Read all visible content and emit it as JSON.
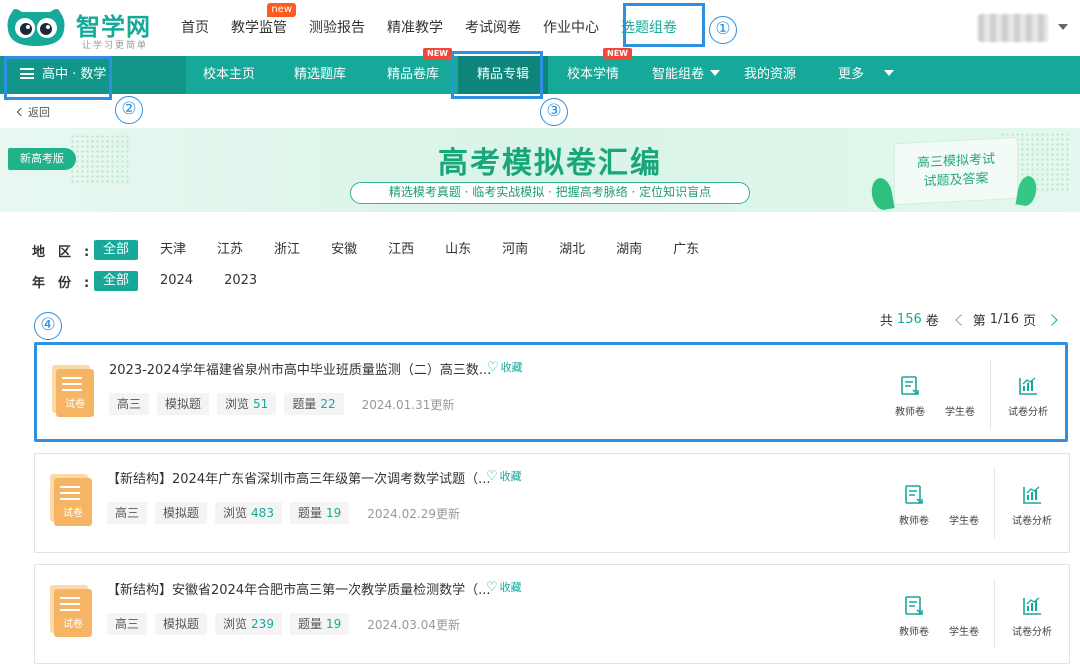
{
  "brand": {
    "name": "智学网",
    "slogan": "让学习更简单",
    "accent": "#16a99a"
  },
  "top_nav": [
    {
      "label": "首页"
    },
    {
      "label": "教学监管",
      "badge": "new"
    },
    {
      "label": "测验报告"
    },
    {
      "label": "精准教学"
    },
    {
      "label": "考试阅卷"
    },
    {
      "label": "作业中心"
    },
    {
      "label": "选题组卷",
      "active": true
    }
  ],
  "sub_nav": {
    "subject": "高中 · 数学",
    "items": [
      {
        "label": "校本主页"
      },
      {
        "label": "精选题库"
      },
      {
        "label": "精品卷库",
        "badge": "NEW"
      },
      {
        "label": "精品专辑",
        "active": true
      },
      {
        "label": "校本学情",
        "badge": "NEW"
      },
      {
        "label": "智能组卷",
        "dropdown": true
      },
      {
        "label": "我的资源"
      },
      {
        "label": "更多",
        "dropdown": true
      }
    ]
  },
  "back_label": "返回",
  "banner": {
    "tag": "新高考版",
    "title": "高考模拟卷汇编",
    "subtitle": "精选模考真题 · 临考实战模拟 · 把握高考脉络 · 定位知识盲点",
    "card_line1": "高三模拟考试",
    "card_line2": "试题及答案"
  },
  "filters": {
    "region_label": "地区",
    "regions": [
      "全部",
      "天津",
      "江苏",
      "浙江",
      "安徽",
      "江西",
      "山东",
      "河南",
      "湖北",
      "湖南",
      "广东"
    ],
    "year_label": "年份",
    "years": [
      "全部",
      "2024",
      "2023"
    ]
  },
  "pager": {
    "total_prefix": "共",
    "total": "156",
    "total_suffix": "卷",
    "page_prefix": "第",
    "page": "1/16",
    "page_suffix": "页"
  },
  "papers": [
    {
      "icon_label": "试卷",
      "title": "2023-2024学年福建省泉州市高中毕业班质量监测（二）高三数...",
      "fav_label": "收藏",
      "grade": "高三",
      "kind": "模拟题",
      "views_label": "浏览",
      "views": "51",
      "questions_label": "题量",
      "questions": "22",
      "date": "2024.01.31更新",
      "teacher_label": "教师卷",
      "student_label": "学生卷",
      "analysis_label": "试卷分析"
    },
    {
      "icon_label": "试卷",
      "title": "【新结构】2024年广东省深圳市高三年级第一次调考数学试题（...",
      "fav_label": "收藏",
      "grade": "高三",
      "kind": "模拟题",
      "views_label": "浏览",
      "views": "483",
      "questions_label": "题量",
      "questions": "19",
      "date": "2024.02.29更新",
      "teacher_label": "教师卷",
      "student_label": "学生卷",
      "analysis_label": "试卷分析"
    },
    {
      "icon_label": "试卷",
      "title": "【新结构】安徽省2024年合肥市高三第一次教学质量检测数学（...",
      "fav_label": "收藏",
      "grade": "高三",
      "kind": "模拟题",
      "views_label": "浏览",
      "views": "239",
      "questions_label": "题量",
      "questions": "19",
      "date": "2024.03.04更新",
      "teacher_label": "教师卷",
      "student_label": "学生卷",
      "analysis_label": "试卷分析"
    }
  ],
  "annotations": [
    "①",
    "②",
    "③",
    "④"
  ],
  "annotation_color": "#2f8fe0"
}
